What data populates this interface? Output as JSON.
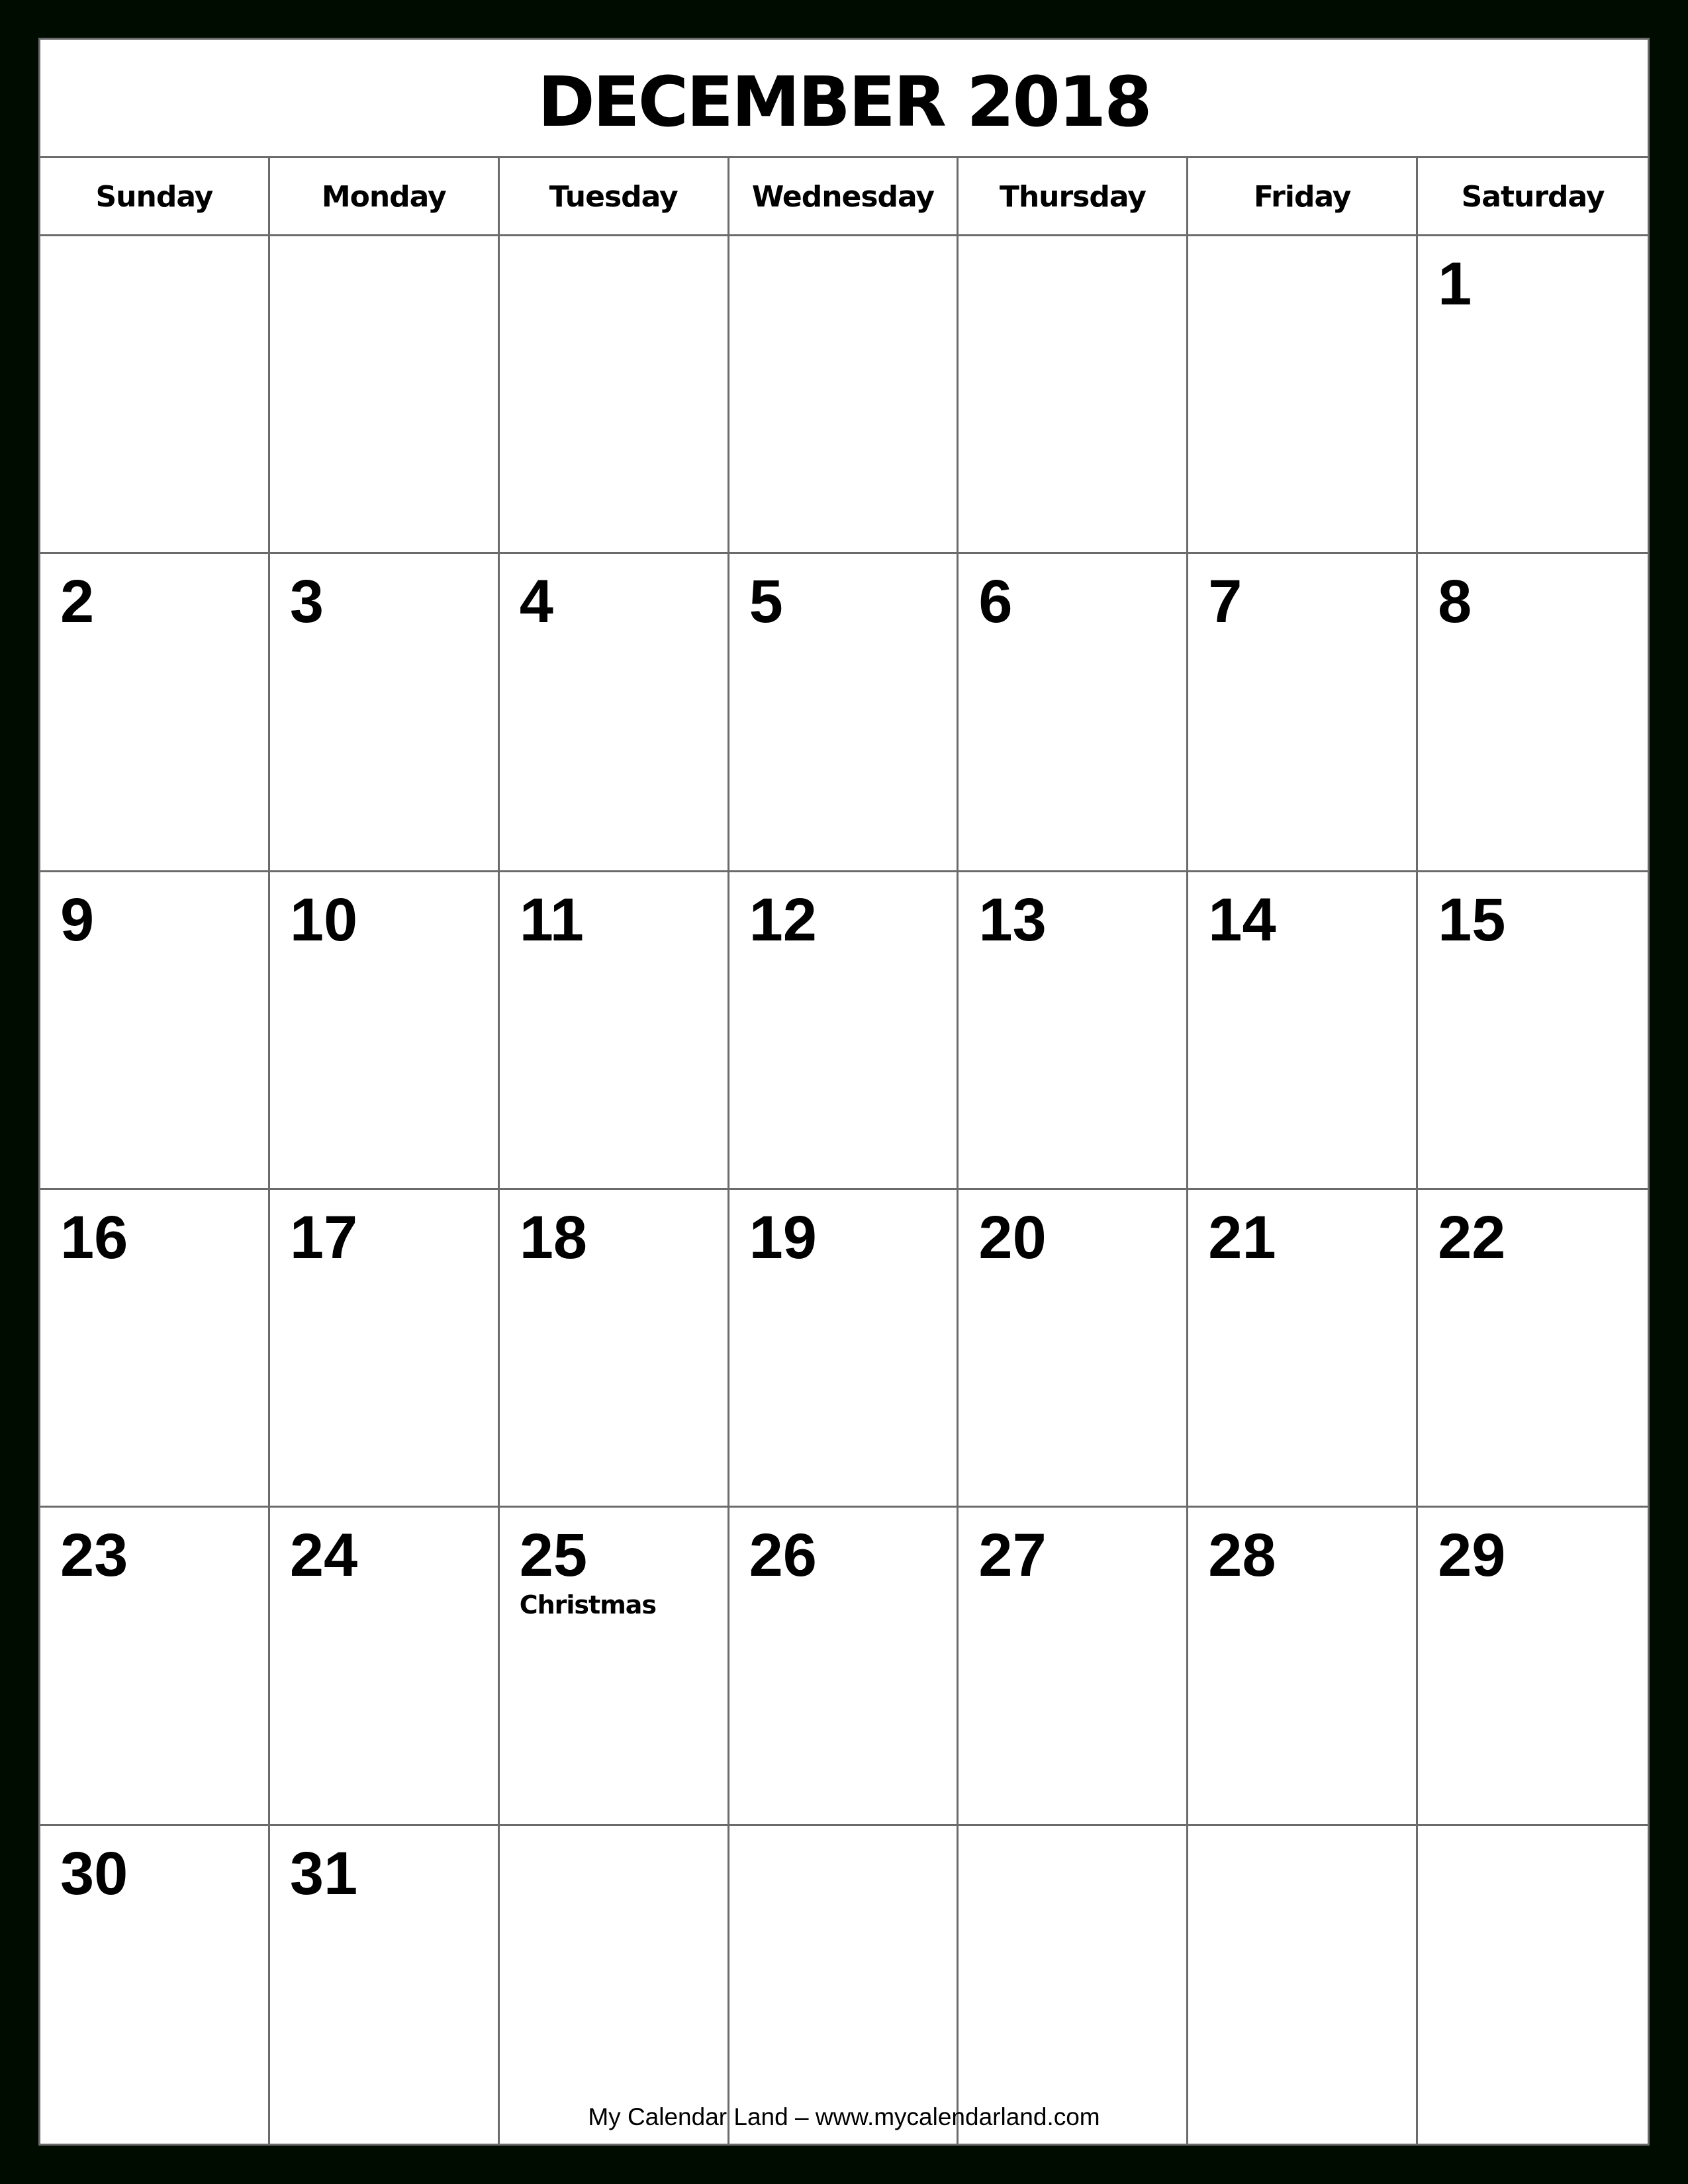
{
  "calendar": {
    "title": "DECEMBER 2018",
    "month": "December",
    "year": 2018,
    "weekdays": [
      "Sunday",
      "Monday",
      "Tuesday",
      "Wednesday",
      "Thursday",
      "Friday",
      "Saturday"
    ],
    "first_weekday_index": 6,
    "days_in_month": 31,
    "weeks": [
      [
        "",
        "",
        "",
        "",
        "",
        "",
        "1"
      ],
      [
        "2",
        "3",
        "4",
        "5",
        "6",
        "7",
        "8"
      ],
      [
        "9",
        "10",
        "11",
        "12",
        "13",
        "14",
        "15"
      ],
      [
        "16",
        "17",
        "18",
        "19",
        "20",
        "21",
        "22"
      ],
      [
        "23",
        "24",
        "25",
        "26",
        "27",
        "28",
        "29"
      ],
      [
        "30",
        "31",
        "",
        "",
        "",
        "",
        ""
      ]
    ],
    "holidays": [
      {
        "day": "25",
        "label": "Christmas"
      }
    ]
  },
  "footer": {
    "text": "My Calendar Land – www.mycalendarland.com"
  },
  "colors": {
    "background": "#000c00",
    "grid_line": "#6b6b6b",
    "page": "#ffffff",
    "text": "#000000"
  }
}
